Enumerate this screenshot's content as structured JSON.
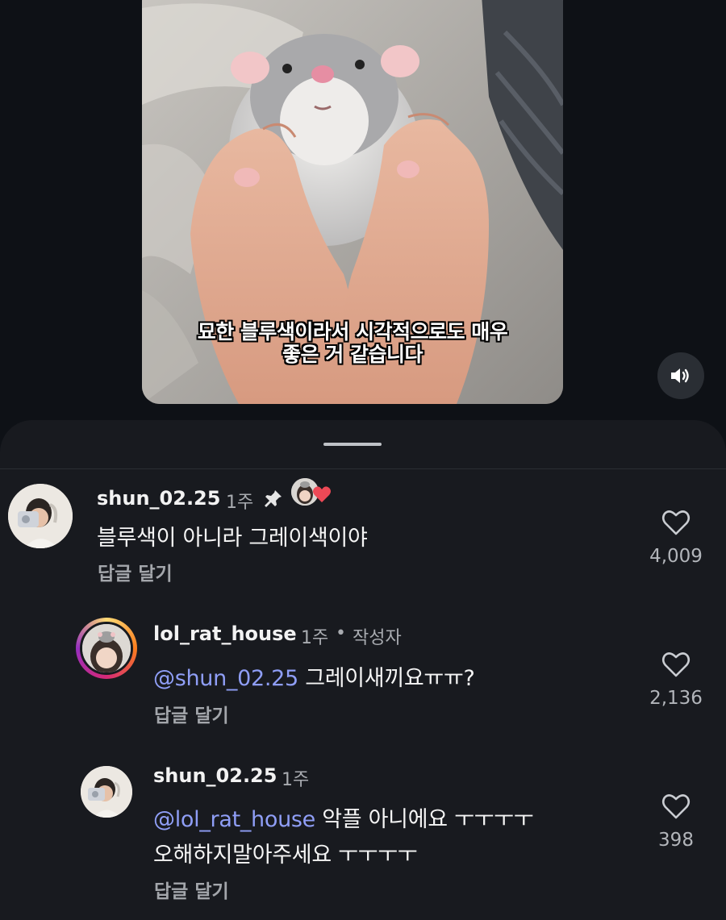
{
  "video": {
    "caption_line1": "묘한 블루색이라서 시각적으로도 매우",
    "caption_line2": "좋은 거 같습니다",
    "sound_icon": "speaker-on-icon"
  },
  "comments": [
    {
      "username": "shun_02.25",
      "time": "1주",
      "pinned_icon": "pin-icon",
      "liked_by_author_icon": "heart-red-icon",
      "text": "블루색이 아니라 그레이색이야",
      "reply_label": "답글 달기",
      "likes": "4,009"
    },
    {
      "username": "lol_rat_house",
      "time": "1주",
      "separator": "•",
      "badge": "작성자",
      "mention": "@shun_02.25",
      "text": " 그레이새끼요ㅠㅠ?",
      "reply_label": "답글 달기",
      "likes": "2,136"
    },
    {
      "username": "shun_02.25",
      "time": "1주",
      "mention": "@lol_rat_house",
      "text": " 악플 아니에요 ㅜㅜㅜㅜ",
      "text_line2": "오해하지말아주세요 ㅜㅜㅜㅜ",
      "reply_label": "답글 달기",
      "likes": "398"
    }
  ],
  "colors": {
    "background": "#0e1116",
    "sheet": "#181a1f",
    "mention": "#8f9ef6",
    "like_heart": "#ed4956"
  }
}
